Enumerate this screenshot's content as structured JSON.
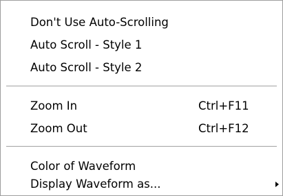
{
  "context_menu": {
    "groups": [
      {
        "items": [
          {
            "label": "Don't Use Auto-Scrolling"
          },
          {
            "label": "Auto Scroll - Style 1"
          },
          {
            "label": "Auto Scroll - Style 2"
          }
        ]
      },
      {
        "items": [
          {
            "label": "Zoom In",
            "shortcut": "Ctrl+F11"
          },
          {
            "label": "Zoom Out",
            "shortcut": "Ctrl+F12"
          }
        ]
      },
      {
        "items": [
          {
            "label": "Color of Waveform"
          },
          {
            "label": "Display Waveform as...",
            "submenu_icon": "triangle-right-icon"
          }
        ]
      }
    ],
    "colors": {
      "background": "#ffffff",
      "text": "#000000",
      "border": "#9d9d9d",
      "separator": "#a0a0a0"
    }
  }
}
